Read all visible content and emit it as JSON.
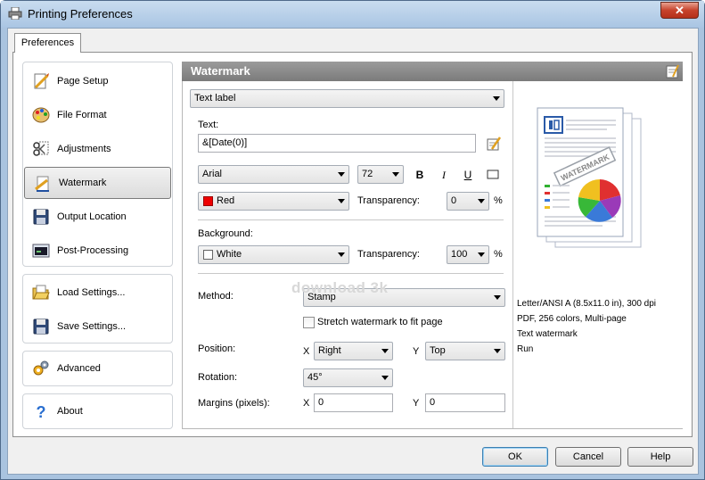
{
  "window": {
    "title": "Printing Preferences",
    "close_glyph": "✕"
  },
  "tabs": [
    {
      "label": "Preferences"
    }
  ],
  "nav": {
    "group1": [
      {
        "label": "Page Setup",
        "icon": "page-setup-icon"
      },
      {
        "label": "File Format",
        "icon": "palette-icon"
      },
      {
        "label": "Adjustments",
        "icon": "scissors-icon"
      },
      {
        "label": "Watermark",
        "icon": "watermark-icon",
        "selected": true
      },
      {
        "label": "Output Location",
        "icon": "floppy-disk-icon"
      },
      {
        "label": "Post-Processing",
        "icon": "terminal-icon"
      }
    ],
    "group2": [
      {
        "label": "Load Settings...",
        "icon": "folder-open-icon"
      },
      {
        "label": "Save Settings...",
        "icon": "save-icon"
      }
    ],
    "group3": [
      {
        "label": "Advanced",
        "icon": "gears-icon"
      }
    ],
    "group4": [
      {
        "label": "About",
        "icon": "help-icon"
      }
    ]
  },
  "section": {
    "title": "Watermark"
  },
  "form": {
    "watermark_type": "Text label",
    "text_label": "Text:",
    "text_value": "&[Date(0)]",
    "font": "Arial",
    "font_size": "72",
    "bold": "B",
    "italic": "I",
    "underline": "U",
    "color_value": "Red",
    "transparency_label": "Transparency:",
    "transparency_value": "0",
    "percent": "%",
    "background_label": "Background:",
    "background_value": "White",
    "bg_transparency_value": "100",
    "method_label": "Method:",
    "method_value": "Stamp",
    "stretch_label": "Stretch watermark to fit page",
    "position_label": "Position:",
    "x_label": "X",
    "y_label": "Y",
    "position_x": "Right",
    "position_y": "Top",
    "rotation_label": "Rotation:",
    "rotation_value": "45°",
    "margins_label": "Margins (pixels):",
    "margin_x": "0",
    "margin_y": "0"
  },
  "preview": {
    "stamp_text": "WATERMARK",
    "info": [
      "Letter/ANSI A (8.5x11.0 in), 300 dpi",
      "PDF, 256 colors, Multi-page",
      "Text watermark",
      "Run"
    ]
  },
  "brand_watermark": "download 3k",
  "buttons": {
    "ok": "OK",
    "cancel": "Cancel",
    "help": "Help"
  },
  "colors": {
    "red": "#ee0000",
    "white": "#ffffff",
    "header": "#8a8a8a"
  }
}
